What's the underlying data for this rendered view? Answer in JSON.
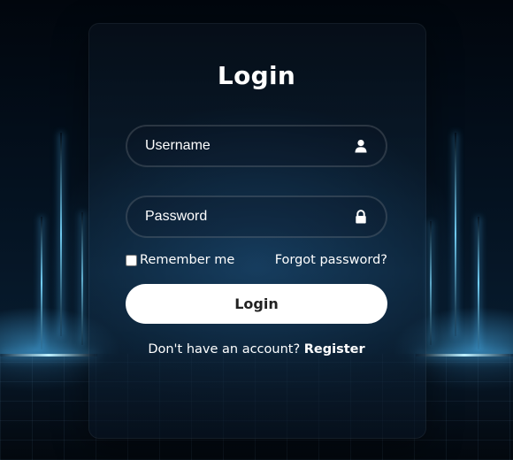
{
  "login_form": {
    "title": "Login",
    "username": {
      "placeholder": "Username",
      "value": ""
    },
    "password": {
      "placeholder": "Password",
      "value": ""
    },
    "remember_label": "Remember me",
    "remember_checked": false,
    "forgot_label": "Forgot password?",
    "submit_label": "Login",
    "register_prompt": "Don't have an account?",
    "register_link": "Register"
  },
  "icons": {
    "username": "user-icon",
    "password": "lock-icon"
  },
  "colors": {
    "accent_glow": "#5ac8ff",
    "button_bg": "#ffffff",
    "button_text": "#222222",
    "text": "#ffffff"
  }
}
